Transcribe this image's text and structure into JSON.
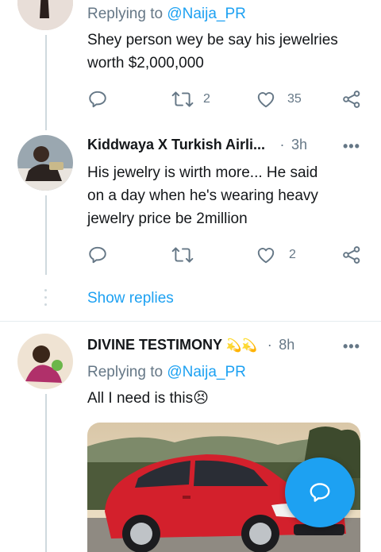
{
  "tweet1": {
    "replying_prefix": "Replying to ",
    "replying_handle": "@Naija_PR",
    "text_line1": "Shey person wey be say his jewelries",
    "text_line2": "worth $2,000,000",
    "retweets": "2",
    "likes": "35"
  },
  "tweet2": {
    "name": "Kiddwaya X Turkish Airli...",
    "separator": "·",
    "time": "3h",
    "text_line1": "His jewelry is wirth more... He said",
    "text_line2": "on a day when he's wearing heavy",
    "text_line3": "jewelry price be 2million",
    "retweets": "",
    "likes": "2",
    "show_replies": "Show replies"
  },
  "tweet3": {
    "name": "DIVINE TESTIMONY",
    "name_emojis": "💫💫",
    "separator": "·",
    "time": "8h",
    "replying_prefix": "Replying to ",
    "replying_handle": "@Naija_PR",
    "text": "All I need is this",
    "text_emoji": "😣"
  },
  "more_label": "•••",
  "colors": {
    "accent": "#1da1f2",
    "muted": "#657786",
    "car": "#d3202c"
  },
  "icons": [
    "reply-icon",
    "retweet-icon",
    "like-icon",
    "share-icon",
    "more-icon",
    "compose-reply-icon"
  ]
}
